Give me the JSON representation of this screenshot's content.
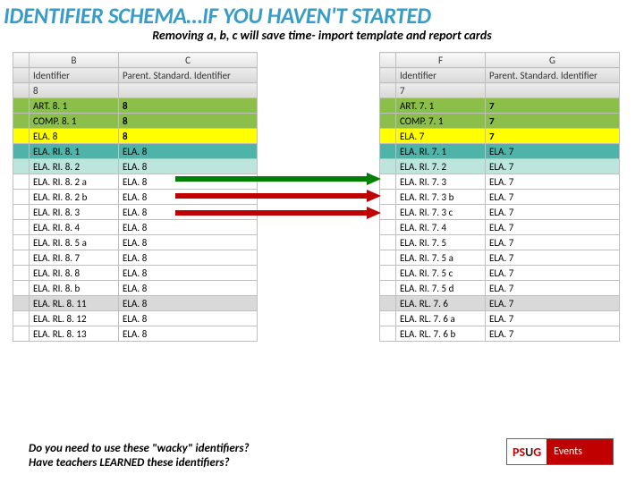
{
  "title": "IDENTIFIER SCHEMA…IF YOU HAVEN'T STARTED",
  "subtitle": "Removing a, b, c will save time- import template and report cards",
  "left": {
    "colA": "",
    "colB": "B",
    "colC": "C",
    "h1": "Identifier",
    "h2": "Parent. Standard. Identifier",
    "grade": "8",
    "rows": [
      {
        "cls": "green",
        "a": "ART. 8. 1",
        "b": "8"
      },
      {
        "cls": "green",
        "a": "COMP. 8. 1",
        "b": "8"
      },
      {
        "cls": "yellow",
        "a": "ELA. 8",
        "b": "8"
      },
      {
        "cls": "teal",
        "a": "ELA. RI. 8. 1",
        "b": "ELA. 8"
      },
      {
        "cls": "teal2",
        "a": "ELA. RI. 8. 2",
        "b": "ELA. 8"
      },
      {
        "cls": "",
        "a": "ELA. RI. 8. 2 a",
        "b": "ELA. 8"
      },
      {
        "cls": "",
        "a": "ELA. RI. 8. 2 b",
        "b": "ELA. 8"
      },
      {
        "cls": "",
        "a": "ELA. RI. 8. 3",
        "b": "ELA. 8"
      },
      {
        "cls": "",
        "a": "ELA. RI. 8. 4",
        "b": "ELA. 8"
      },
      {
        "cls": "",
        "a": "ELA. RI. 8. 5 a",
        "b": "ELA. 8"
      },
      {
        "cls": "",
        "a": "ELA. RI. 8. 7",
        "b": "ELA. 8"
      },
      {
        "cls": "",
        "a": "ELA. RI. 8. 8",
        "b": "ELA. 8"
      },
      {
        "cls": "",
        "a": "ELA. RI. 8. b",
        "b": "ELA. 8"
      },
      {
        "cls": "grey",
        "a": "ELA. RL. 8. 11",
        "b": "ELA. 8"
      },
      {
        "cls": "",
        "a": "ELA. RL. 8. 12",
        "b": "ELA. 8"
      },
      {
        "cls": "",
        "a": "ELA. RL. 8. 13",
        "b": "ELA. 8"
      }
    ]
  },
  "right": {
    "colB": "F",
    "colC": "G",
    "h1": "Identifier",
    "h2": "Parent. Standard. Identifier",
    "grade": "7",
    "rows": [
      {
        "cls": "green",
        "a": "ART. 7. 1",
        "b": "7"
      },
      {
        "cls": "green",
        "a": "COMP. 7. 1",
        "b": "7"
      },
      {
        "cls": "yellow",
        "a": "ELA. 7",
        "b": "7"
      },
      {
        "cls": "teal",
        "a": "ELA. RI. 7. 1",
        "b": "ELA. 7"
      },
      {
        "cls": "teal2",
        "a": "ELA. RI. 7. 2",
        "b": "ELA. 7"
      },
      {
        "cls": "",
        "a": "ELA. RI. 7. 3",
        "b": "ELA. 7"
      },
      {
        "cls": "",
        "a": "ELA. RI. 7. 3 b",
        "b": "ELA. 7"
      },
      {
        "cls": "",
        "a": "ELA. RI. 7. 3 c",
        "b": "ELA. 7"
      },
      {
        "cls": "",
        "a": "ELA. RI. 7. 4",
        "b": "ELA. 7"
      },
      {
        "cls": "",
        "a": "ELA. RI. 7. 5",
        "b": "ELA. 7"
      },
      {
        "cls": "",
        "a": "ELA. RI. 7. 5 a",
        "b": "ELA. 7"
      },
      {
        "cls": "",
        "a": "ELA. RI. 7. 5 c",
        "b": "ELA. 7"
      },
      {
        "cls": "",
        "a": "ELA. RI. 7. 5 d",
        "b": "ELA. 7"
      },
      {
        "cls": "grey",
        "a": "ELA. RL. 7. 6",
        "b": "ELA. 7"
      },
      {
        "cls": "",
        "a": "ELA. RL. 7. 6 a",
        "b": "ELA. 7"
      },
      {
        "cls": "",
        "a": "ELA. RL. 7. 6 b",
        "b": "ELA. 7"
      }
    ]
  },
  "footer": {
    "line1": "Do you need to use these \"wacky\" identifiers?",
    "line2": "Have teachers LEARNED these identifiers?"
  },
  "logo": {
    "p1a": "PS",
    "p1b": "U",
    "p1c": "G",
    "p2": "Events"
  }
}
